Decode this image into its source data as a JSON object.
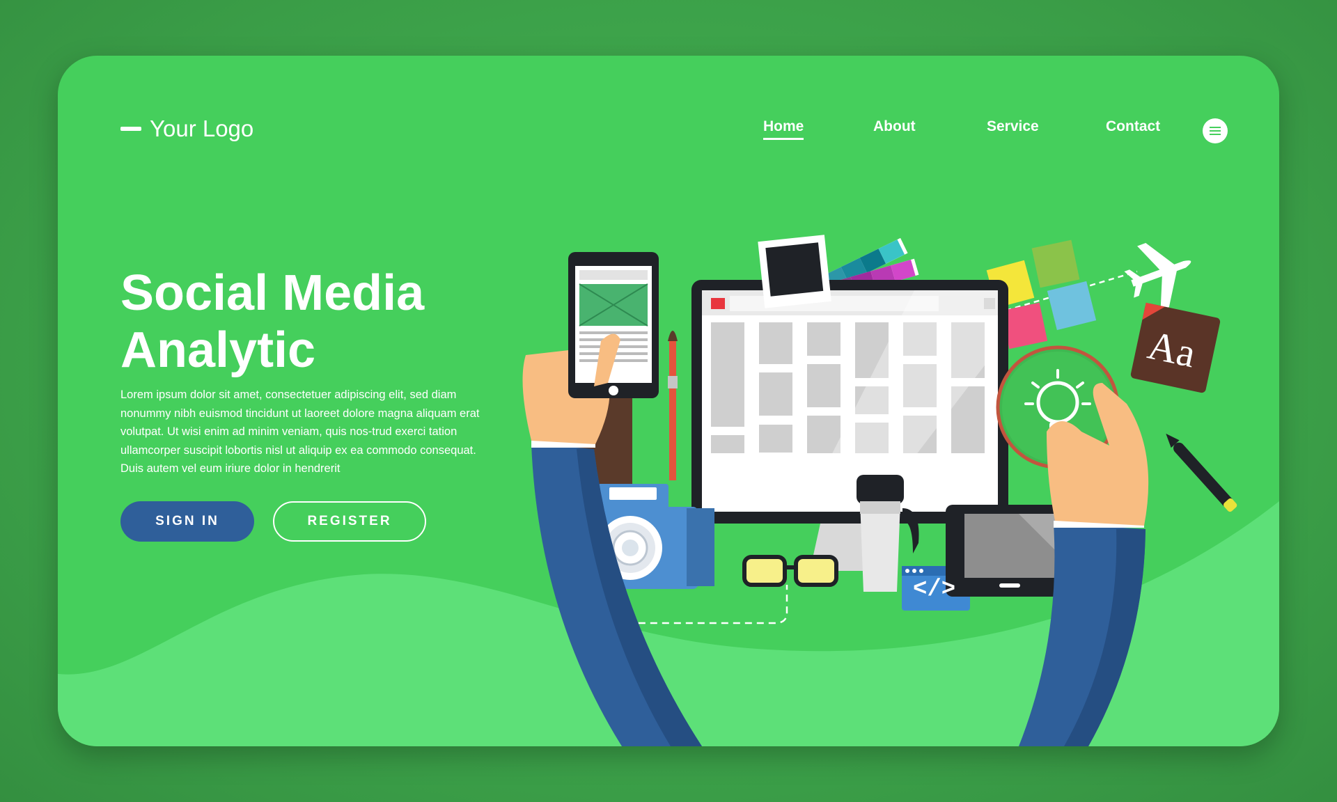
{
  "header": {
    "logo_text": "Your Logo",
    "nav": [
      {
        "label": "Home",
        "active": true
      },
      {
        "label": "About",
        "active": false
      },
      {
        "label": "Service",
        "active": false
      },
      {
        "label": "Contact",
        "active": false
      }
    ]
  },
  "hero": {
    "title_line1": "Social Media",
    "title_line2": "Analytic",
    "body": "Lorem ipsum dolor sit amet, consectetuer adipiscing elit, sed diam nonummy nibh euismod tincidunt ut laoreet dolore magna aliquam erat volutpat. Ut wisi enim ad minim veniam, quis nos-trud exerci tation ullamcorper suscipit lobortis nisl ut aliquip ex ea commodo consequat. Duis autem vel eum iriure dolor in hendrerit",
    "signin_label": "SIGN IN",
    "register_label": "REGISTER"
  },
  "illustration": {
    "font_card_text": "Aa",
    "code_icon_text": "</>"
  },
  "colors": {
    "background": "#3b9e48",
    "card": "#45cf5c",
    "wave": "#5de078",
    "button_primary": "#2f5f9a",
    "sleeve": "#2f5f9a",
    "skin": "#f8bd82"
  }
}
